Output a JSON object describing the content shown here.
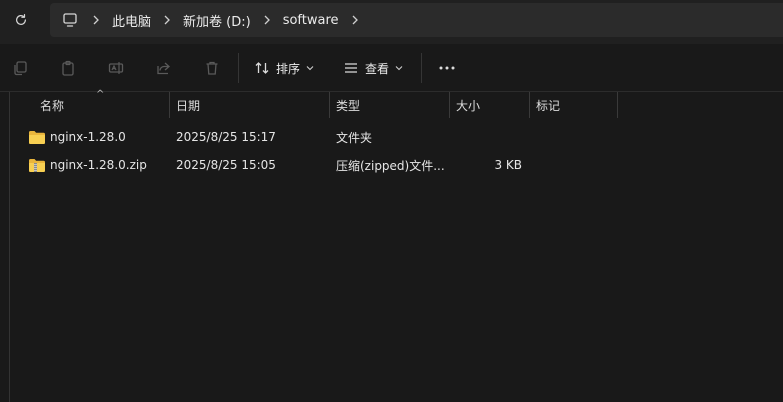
{
  "address": {
    "crumbs": [
      "此电脑",
      "新加卷 (D:)",
      "software"
    ]
  },
  "toolbar": {
    "sort_label": "排序",
    "view_label": "查看"
  },
  "columns": [
    "名称",
    "日期",
    "类型",
    "大小",
    "标记"
  ],
  "rows": [
    {
      "name": "nginx-1.28.0",
      "date": "2025/8/25 15:17",
      "type": "文件夹",
      "size": "",
      "icon": "folder-icon"
    },
    {
      "name": "nginx-1.28.0.zip",
      "date": "2025/8/25 15:05",
      "type": "压缩(zipped)文件...",
      "size": "3 KB",
      "icon": "zip-folder-icon"
    }
  ],
  "colors": {
    "folder": "#f4c644",
    "background": "#191919",
    "address_bg": "#2b2b2b"
  }
}
